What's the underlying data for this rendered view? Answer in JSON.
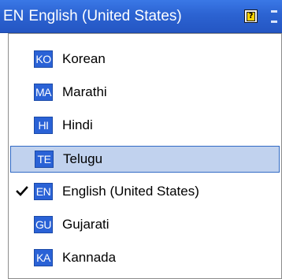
{
  "language_bar": {
    "code": "EN",
    "language": "English (United States)",
    "help_icon": "help-question-icon",
    "options_icon": "options-icon",
    "background": "#2c63d2"
  },
  "menu": {
    "highlight_color": "#c1d2ee",
    "badge_color": "#2a62d6",
    "items": [
      {
        "code": "KO",
        "label": "Korean",
        "checked": false,
        "highlighted": false
      },
      {
        "code": "MA",
        "label": "Marathi",
        "checked": false,
        "highlighted": false
      },
      {
        "code": "HI",
        "label": "Hindi",
        "checked": false,
        "highlighted": false
      },
      {
        "code": "TE",
        "label": "Telugu",
        "checked": false,
        "highlighted": true
      },
      {
        "code": "EN",
        "label": "English (United States)",
        "checked": true,
        "highlighted": false
      },
      {
        "code": "GU",
        "label": "Gujarati",
        "checked": false,
        "highlighted": false
      },
      {
        "code": "KA",
        "label": "Kannada",
        "checked": false,
        "highlighted": false
      }
    ]
  }
}
